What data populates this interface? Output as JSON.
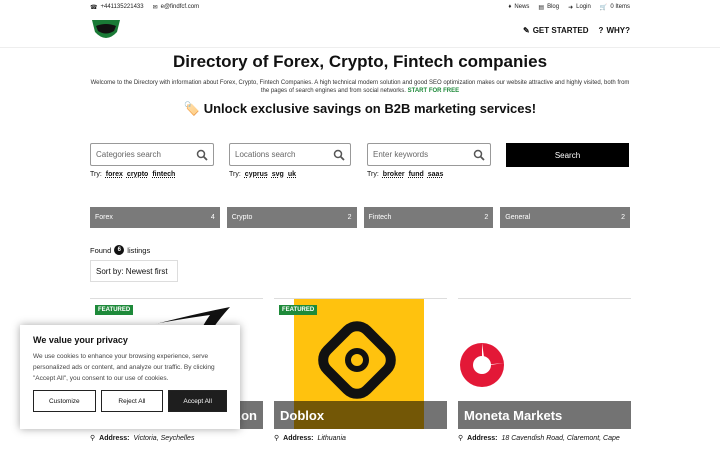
{
  "topbar": {
    "phone": "+441135221433",
    "email": "e@findfcf.com",
    "news": "News",
    "blog": "Blog",
    "login": "Login",
    "cart": "0 Items"
  },
  "nav": {
    "get_started": "GET STARTED",
    "why": "WHY?"
  },
  "page": {
    "title": "Directory of Forex, Crypto, Fintech companies",
    "intro": "Welcome to the Directory with information about Forex, Crypto, Fintech Companies. A high technical modern solution and good SEO optimization makes our website attractive and highly visited, both from the pages of search engines and from social networks.",
    "start_link": "START FOR FREE",
    "promo": "🏷️ Unlock exclusive savings on B2B marketing services!"
  },
  "search": {
    "categories_placeholder": "Categories search",
    "locations_placeholder": "Locations search",
    "keywords_placeholder": "Enter keywords",
    "button": "Search",
    "try_label": "Try:",
    "try_categories": [
      "forex",
      "crypto",
      "fintech"
    ],
    "try_locations": [
      "cyprus",
      "svg",
      "uk"
    ],
    "try_keywords": [
      "broker",
      "fund",
      "saas"
    ]
  },
  "categories": [
    {
      "name": "Forex",
      "count": "4"
    },
    {
      "name": "Crypto",
      "count": "2"
    },
    {
      "name": "Fintech",
      "count": "2"
    },
    {
      "name": "General",
      "count": "2"
    }
  ],
  "listings": {
    "found_label": "Found",
    "count": "6",
    "listings_label": "listings",
    "sort": "Sort by: Newest first"
  },
  "cards": [
    {
      "title": "...on",
      "badge": "FEATURED",
      "address_label": "Address:",
      "address": "Victoria, Seychelles"
    },
    {
      "title": "Doblox",
      "badge": "FEATURED",
      "address_label": "Address:",
      "address": "Lithuania"
    },
    {
      "title": "Moneta Markets",
      "address_label": "Address:",
      "address": "18 Cavendish Road, Claremont, Cape"
    }
  ],
  "cookie": {
    "title": "We value your privacy",
    "text": "We use cookies to enhance your browsing experience, serve personalized ads or content, and analyze our traffic. By clicking \"Accept All\", you consent to our use of cookies.",
    "customize": "Customize",
    "reject": "Reject All",
    "accept": "Accept All"
  },
  "colors": {
    "accent_green": "#1e8a3a",
    "category_gray": "#7a7a7a",
    "doblox_yellow": "#ffc20e",
    "moneta_red": "#e31837"
  }
}
